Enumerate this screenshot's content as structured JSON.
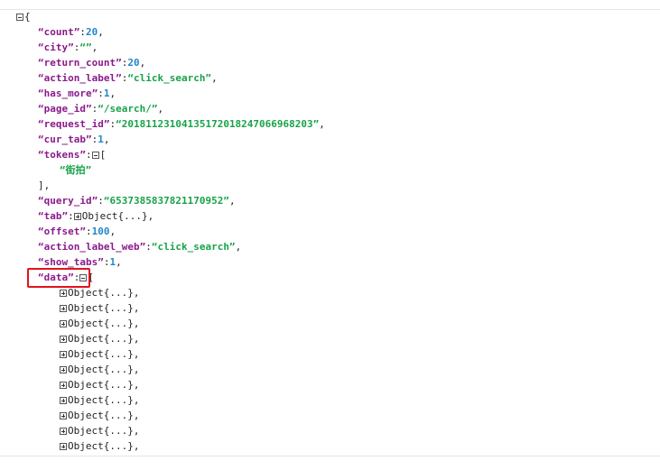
{
  "json_viewer": {
    "root_open": "{",
    "fields": [
      {
        "key": "“count”",
        "value": "20",
        "type": "num"
      },
      {
        "key": "“city”",
        "value": "“”",
        "type": "str"
      },
      {
        "key": "“return_count”",
        "value": "20",
        "type": "num"
      },
      {
        "key": "“action_label”",
        "value": "“click_search”",
        "type": "str"
      },
      {
        "key": "“has_more”",
        "value": "1",
        "type": "num"
      },
      {
        "key": "“page_id”",
        "value": "“/search/”",
        "type": "str"
      },
      {
        "key": "“request_id”",
        "value": "“20181123104135172018247066968203”",
        "type": "str"
      },
      {
        "key": "“cur_tab”",
        "value": "1",
        "type": "num"
      }
    ],
    "tokens": {
      "key": "“tokens”",
      "open": "[",
      "item": "“街拍”",
      "close": "],"
    },
    "fields_2": [
      {
        "key": "“query_id”",
        "value": "“6537385837821170952”",
        "type": "str"
      }
    ],
    "tab": {
      "key": "“tab”",
      "value": "Object{...},"
    },
    "fields_3": [
      {
        "key": "“offset”",
        "value": "100",
        "type": "num"
      },
      {
        "key": "“action_label_web”",
        "value": "“click_search”",
        "type": "str"
      },
      {
        "key": "“show_tabs”",
        "value": "1",
        "type": "num"
      }
    ],
    "data": {
      "key": "“data”",
      "open": "[",
      "items": [
        "Object{...},",
        "Object{...},",
        "Object{...},",
        "Object{...},",
        "Object{...},",
        "Object{...},",
        "Object{...},",
        "Object{...},",
        "Object{...},",
        "Object{...},",
        "Object{...},"
      ]
    }
  },
  "colors": {
    "key": "#8b1a8b",
    "number": "#1f87c9",
    "string": "#19a24a",
    "highlight_border": "#e0141e"
  }
}
